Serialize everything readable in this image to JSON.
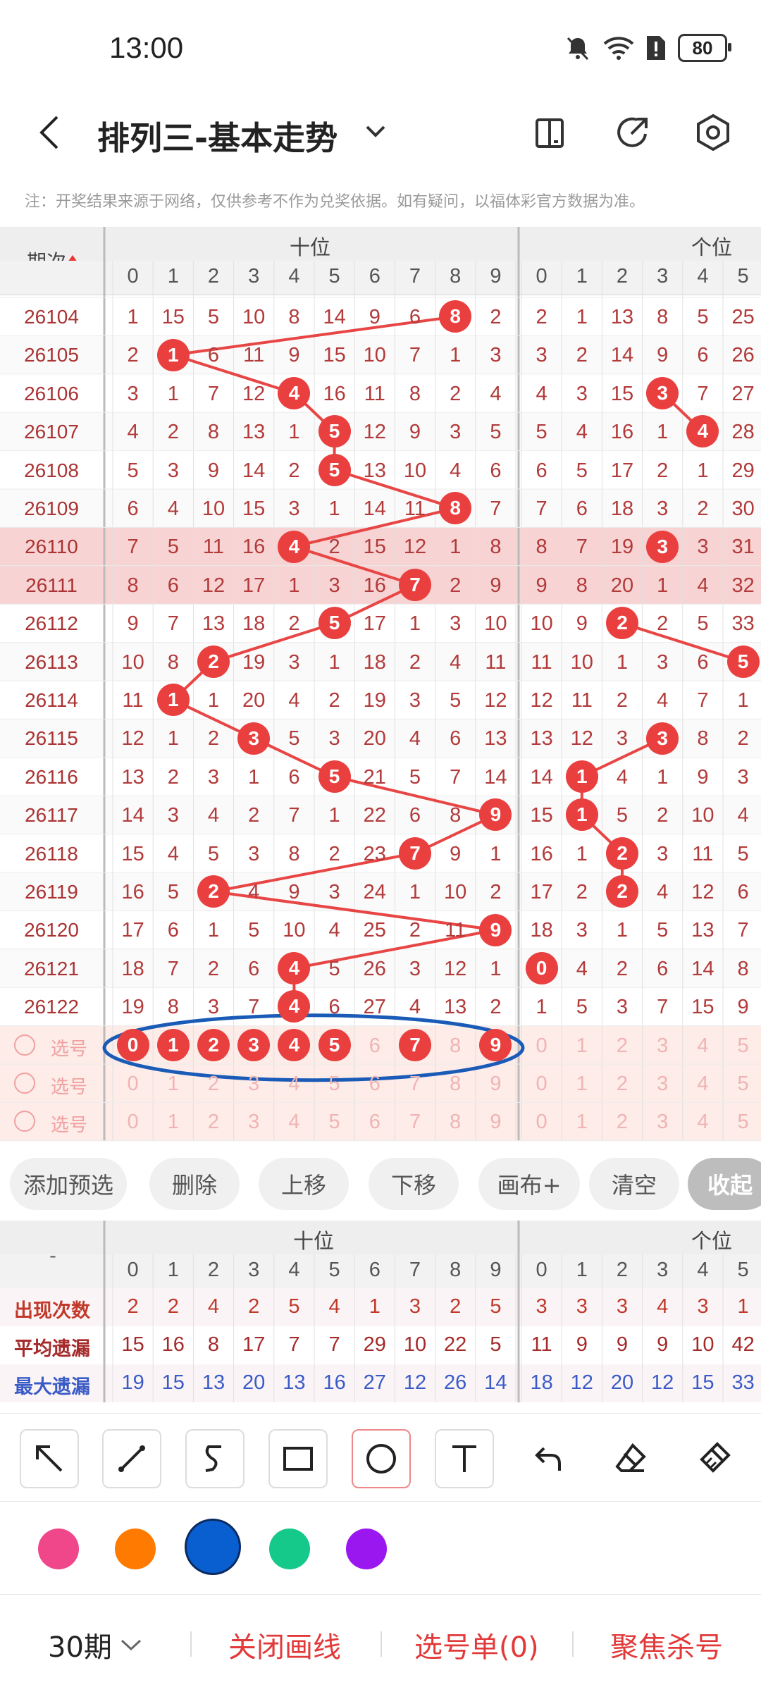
{
  "status": {
    "time": "13:00",
    "battery": "80"
  },
  "header": {
    "title": "排列三-基本走势"
  },
  "note": "注：开奖结果来源于网络，仅供参考不作为兑奖依据。如有疑问，以福体彩官方数据为准。",
  "grid": {
    "period_header": "期次",
    "group1_label": "十位",
    "group2_label": "个位",
    "digits": [
      "0",
      "1",
      "2",
      "3",
      "4",
      "5",
      "6",
      "7",
      "8",
      "9"
    ],
    "digits2": [
      "0",
      "1",
      "2",
      "3",
      "4",
      "5"
    ],
    "rows": [
      {
        "period": "26104",
        "ten": [
          1,
          15,
          5,
          10,
          8,
          14,
          9,
          6,
          8,
          2
        ],
        "one": [
          2,
          1,
          13,
          8,
          5,
          25
        ],
        "ten_hit": 8,
        "one_hit": null,
        "highlight": false
      },
      {
        "period": "26105",
        "ten": [
          2,
          1,
          6,
          11,
          9,
          15,
          10,
          7,
          1,
          3
        ],
        "one": [
          3,
          2,
          14,
          9,
          6,
          26
        ],
        "ten_hit": 1,
        "one_hit": null,
        "highlight": false
      },
      {
        "period": "26106",
        "ten": [
          3,
          1,
          7,
          12,
          4,
          16,
          11,
          8,
          2,
          4
        ],
        "one": [
          4,
          3,
          15,
          3,
          7,
          27
        ],
        "ten_hit": 4,
        "one_hit": 3,
        "highlight": false
      },
      {
        "period": "26107",
        "ten": [
          4,
          2,
          8,
          13,
          1,
          5,
          12,
          9,
          3,
          5
        ],
        "one": [
          5,
          4,
          16,
          1,
          4,
          28
        ],
        "ten_hit": 5,
        "one_hit": 4,
        "highlight": false
      },
      {
        "period": "26108",
        "ten": [
          5,
          3,
          9,
          14,
          2,
          5,
          13,
          10,
          4,
          6
        ],
        "one": [
          6,
          5,
          17,
          2,
          1,
          29
        ],
        "ten_hit": 5,
        "one_hit": null,
        "highlight": false
      },
      {
        "period": "26109",
        "ten": [
          6,
          4,
          10,
          15,
          3,
          1,
          14,
          11,
          8,
          7
        ],
        "one": [
          7,
          6,
          18,
          3,
          2,
          30
        ],
        "ten_hit": 8,
        "one_hit": null,
        "highlight": false
      },
      {
        "period": "26110",
        "ten": [
          7,
          5,
          11,
          16,
          4,
          2,
          15,
          12,
          1,
          8
        ],
        "one": [
          8,
          7,
          19,
          3,
          3,
          31
        ],
        "ten_hit": 4,
        "one_hit": 3,
        "highlight": true
      },
      {
        "period": "26111",
        "ten": [
          8,
          6,
          12,
          17,
          1,
          3,
          16,
          7,
          2,
          9
        ],
        "one": [
          9,
          8,
          20,
          1,
          4,
          32
        ],
        "ten_hit": 7,
        "one_hit": null,
        "highlight": true
      },
      {
        "period": "26112",
        "ten": [
          9,
          7,
          13,
          18,
          2,
          5,
          17,
          1,
          3,
          10
        ],
        "one": [
          10,
          9,
          2,
          2,
          5,
          33
        ],
        "ten_hit": 5,
        "one_hit": 2,
        "highlight": false
      },
      {
        "period": "26113",
        "ten": [
          10,
          8,
          2,
          19,
          3,
          1,
          18,
          2,
          4,
          11
        ],
        "one": [
          11,
          10,
          1,
          3,
          6,
          5
        ],
        "ten_hit": 2,
        "one_hit": 5,
        "highlight": false
      },
      {
        "period": "26114",
        "ten": [
          11,
          1,
          1,
          20,
          4,
          2,
          19,
          3,
          5,
          12
        ],
        "one": [
          12,
          11,
          2,
          4,
          7,
          1
        ],
        "ten_hit": 1,
        "one_hit": null,
        "highlight": false
      },
      {
        "period": "26115",
        "ten": [
          12,
          1,
          2,
          3,
          5,
          3,
          20,
          4,
          6,
          13
        ],
        "one": [
          13,
          12,
          3,
          3,
          8,
          2
        ],
        "ten_hit": 3,
        "one_hit": 3,
        "highlight": false
      },
      {
        "period": "26116",
        "ten": [
          13,
          2,
          3,
          1,
          6,
          5,
          21,
          5,
          7,
          14
        ],
        "one": [
          14,
          1,
          4,
          1,
          9,
          3
        ],
        "ten_hit": 5,
        "one_hit": 1,
        "highlight": false
      },
      {
        "period": "26117",
        "ten": [
          14,
          3,
          4,
          2,
          7,
          1,
          22,
          6,
          8,
          9
        ],
        "one": [
          15,
          1,
          5,
          2,
          10,
          4
        ],
        "ten_hit": 9,
        "one_hit": 1,
        "highlight": false
      },
      {
        "period": "26118",
        "ten": [
          15,
          4,
          5,
          3,
          8,
          2,
          23,
          7,
          9,
          1
        ],
        "one": [
          16,
          1,
          2,
          3,
          11,
          5
        ],
        "ten_hit": 7,
        "one_hit": 2,
        "highlight": false
      },
      {
        "period": "26119",
        "ten": [
          16,
          5,
          2,
          4,
          9,
          3,
          24,
          1,
          10,
          2
        ],
        "one": [
          17,
          2,
          2,
          4,
          12,
          6
        ],
        "ten_hit": 2,
        "one_hit": 2,
        "highlight": false
      },
      {
        "period": "26120",
        "ten": [
          17,
          6,
          1,
          5,
          10,
          4,
          25,
          2,
          11,
          9
        ],
        "one": [
          18,
          3,
          1,
          5,
          13,
          7
        ],
        "ten_hit": 9,
        "one_hit": null,
        "highlight": false
      },
      {
        "period": "26121",
        "ten": [
          18,
          7,
          2,
          6,
          4,
          5,
          26,
          3,
          12,
          1
        ],
        "one": [
          0,
          4,
          2,
          6,
          14,
          8
        ],
        "ten_hit": 4,
        "one_hit": 0,
        "highlight": false
      },
      {
        "period": "26122",
        "ten": [
          19,
          8,
          3,
          7,
          4,
          6,
          27,
          4,
          13,
          2
        ],
        "one": [
          1,
          5,
          3,
          7,
          15,
          9
        ],
        "ten_hit": 4,
        "one_hit": null,
        "highlight": false
      }
    ],
    "select_label": "选号",
    "select_rows": [
      {
        "ten_selected": [
          0,
          1,
          2,
          3,
          4,
          5,
          7,
          9
        ]
      },
      {
        "ten_selected": []
      },
      {
        "ten_selected": []
      }
    ]
  },
  "buttons": [
    "添加预选",
    "删除",
    "上移",
    "下移",
    "画布+",
    "清空",
    "收起"
  ],
  "stats": {
    "header_label": "-",
    "group1_label": "十位",
    "group2_label": "个位",
    "rows": [
      {
        "label": "出现次数",
        "ten": [
          2,
          2,
          4,
          2,
          5,
          4,
          1,
          3,
          2,
          5
        ],
        "one": [
          3,
          3,
          3,
          4,
          3,
          1
        ],
        "color": "#c0392b"
      },
      {
        "label": "平均遗漏",
        "ten": [
          15,
          16,
          8,
          17,
          7,
          7,
          29,
          10,
          22,
          5
        ],
        "one": [
          11,
          9,
          9,
          9,
          10,
          42
        ],
        "color": "#a52a2a"
      },
      {
        "label": "最大遗漏",
        "ten": [
          19,
          15,
          13,
          20,
          13,
          16,
          27,
          12,
          26,
          14
        ],
        "one": [
          18,
          12,
          20,
          12,
          15,
          33
        ],
        "color": "#3a5bc7"
      }
    ]
  },
  "palette": [
    "#f0468a",
    "#ff7a00",
    "#0a5fd0",
    "#15c98a",
    "#9a17f0"
  ],
  "bottom": {
    "periods": "30期",
    "close_draw": "关闭画线",
    "select_list": "选号单(0)",
    "focus_kill": "聚焦杀号"
  }
}
